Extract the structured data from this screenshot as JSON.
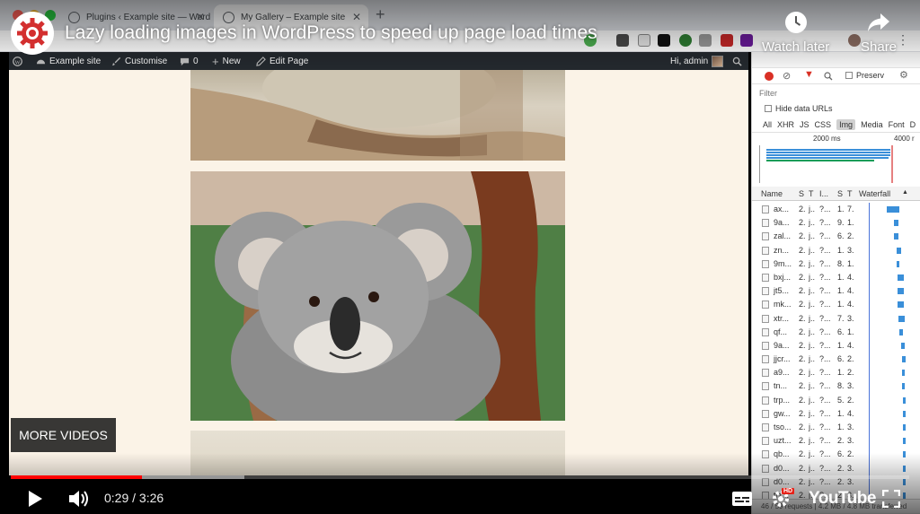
{
  "browser": {
    "tabs": [
      {
        "label": "Plugins ‹ Example site — Word"
      },
      {
        "label": "My Gallery – Example site"
      }
    ]
  },
  "adminbar": {
    "site_name": "Example site",
    "customise": "Customise",
    "comments_count": "0",
    "new": "New",
    "edit_page": "Edit Page",
    "greeting": "Hi, admin"
  },
  "devtools": {
    "filter_placeholder": "Filter",
    "preserve_log": "Preserv",
    "hide_data_urls": "Hide data URLs",
    "type_tabs": [
      "All",
      "XHR",
      "JS",
      "CSS",
      "Img",
      "Media",
      "Font",
      "D"
    ],
    "active_type": "Img",
    "timeline_labels": [
      "2000 ms",
      "4000 r"
    ],
    "columns": [
      "Name",
      "S",
      "T",
      "I...",
      "S",
      "T",
      "Waterfall"
    ],
    "requests": [
      {
        "name": "ax...",
        "s": "2.",
        "t": "j..",
        "i": "?...",
        "s2": "1.",
        "t2": "7."
      },
      {
        "name": "9a...",
        "s": "2.",
        "t": "j..",
        "i": "?...",
        "s2": "9.",
        "t2": "1."
      },
      {
        "name": "zal...",
        "s": "2.",
        "t": "j..",
        "i": "?...",
        "s2": "6.",
        "t2": "2."
      },
      {
        "name": "zn...",
        "s": "2.",
        "t": "j..",
        "i": "?...",
        "s2": "1.",
        "t2": "3."
      },
      {
        "name": "9m...",
        "s": "2.",
        "t": "j..",
        "i": "?...",
        "s2": "8.",
        "t2": "1."
      },
      {
        "name": "bxj...",
        "s": "2.",
        "t": "j..",
        "i": "?...",
        "s2": "1.",
        "t2": "4."
      },
      {
        "name": "jt5...",
        "s": "2.",
        "t": "j..",
        "i": "?...",
        "s2": "1.",
        "t2": "4."
      },
      {
        "name": "mk...",
        "s": "2.",
        "t": "j..",
        "i": "?...",
        "s2": "1.",
        "t2": "4."
      },
      {
        "name": "xtr...",
        "s": "2.",
        "t": "j..",
        "i": "?...",
        "s2": "7.",
        "t2": "3."
      },
      {
        "name": "qf...",
        "s": "2.",
        "t": "j..",
        "i": "?...",
        "s2": "6.",
        "t2": "1."
      },
      {
        "name": "9a...",
        "s": "2.",
        "t": "j..",
        "i": "?...",
        "s2": "1.",
        "t2": "4."
      },
      {
        "name": "jjcr...",
        "s": "2.",
        "t": "j..",
        "i": "?...",
        "s2": "6.",
        "t2": "2."
      },
      {
        "name": "a9...",
        "s": "2.",
        "t": "j..",
        "i": "?...",
        "s2": "1.",
        "t2": "2."
      },
      {
        "name": "tn...",
        "s": "2.",
        "t": "j..",
        "i": "?...",
        "s2": "8.",
        "t2": "3."
      },
      {
        "name": "trp...",
        "s": "2.",
        "t": "j..",
        "i": "?...",
        "s2": "5.",
        "t2": "2."
      },
      {
        "name": "gw...",
        "s": "2.",
        "t": "j..",
        "i": "?...",
        "s2": "1.",
        "t2": "4."
      },
      {
        "name": "tso...",
        "s": "2.",
        "t": "j..",
        "i": "?...",
        "s2": "1.",
        "t2": "3."
      },
      {
        "name": "uzt...",
        "s": "2.",
        "t": "j..",
        "i": "?...",
        "s2": "2.",
        "t2": "3."
      },
      {
        "name": "qb...",
        "s": "2.",
        "t": "j..",
        "i": "?...",
        "s2": "6.",
        "t2": "2."
      },
      {
        "name": "d0...",
        "s": "2.",
        "t": "j..",
        "i": "?...",
        "s2": "2.",
        "t2": "3."
      },
      {
        "name": "d0...",
        "s": "2.",
        "t": "j..",
        "i": "?...",
        "s2": "2.",
        "t2": "3."
      },
      {
        "name": "tfz...",
        "s": "2.",
        "t": "j..",
        "i": "?...",
        "s2": "2.",
        "t2": "3."
      }
    ],
    "status_bar": "46 / 59 requests | 4.2 MB / 4.8 MB transferred"
  },
  "video": {
    "title": "Lazy loading images in WordPress to speed up page load times",
    "watch_later": "Watch later",
    "share": "Share",
    "more_videos": "MORE VIDEOS",
    "current_time": "0:29",
    "duration": "3:26",
    "time_display": "0:29 / 3:26",
    "progress_played": 0.146,
    "progress_buffered": 0.26,
    "brand": "YouTube",
    "hd_badge": "HD"
  },
  "colors": {
    "adminbar_bg": "#23282d",
    "page_bg": "#fbf3e7",
    "progress_red": "#ff0000",
    "waterfall_blue": "#3a8fd9",
    "record_red": "#d93025"
  }
}
